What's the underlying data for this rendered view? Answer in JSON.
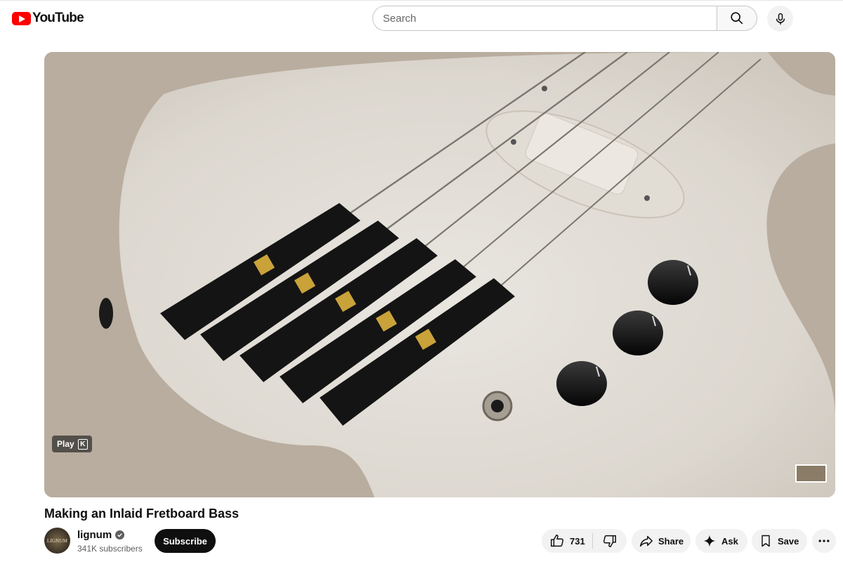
{
  "header": {
    "logo_text": "YouTube",
    "search_placeholder": "Search",
    "search_value": ""
  },
  "player": {
    "play_label": "Play",
    "play_shortcut": "K"
  },
  "video": {
    "title": "Making an Inlaid Fretboard Bass"
  },
  "channel": {
    "name": "lignum",
    "avatar_text": "LIGNUM",
    "subscribers": "341K subscribers",
    "subscribe_label": "Subscribe"
  },
  "actions": {
    "like_count": "731",
    "share_label": "Share",
    "ask_label": "Ask",
    "save_label": "Save"
  },
  "icons": [
    "youtube-logo-icon",
    "search-icon",
    "microphone-icon",
    "verified-icon",
    "thumbs-up-icon",
    "thumbs-down-icon",
    "share-icon",
    "sparkle-icon",
    "bookmark-icon",
    "more-icon"
  ],
  "colors": {
    "brand_red": "#ff0000",
    "subscribe_bg": "#0f0f0f",
    "pill_bg": "#f2f2f2"
  }
}
